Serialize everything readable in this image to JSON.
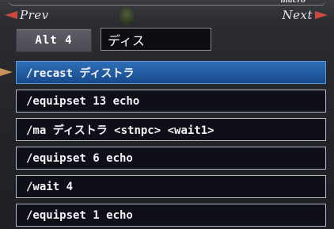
{
  "header": {
    "prev_label": "Prev",
    "next_label": "Next",
    "macro_label": "macro"
  },
  "set": {
    "alt_label": "Alt 4",
    "macro_name": "ディス"
  },
  "macro_lines": [
    "/recast ディストラ",
    "/equipset 13 echo",
    "/ma ディストラ <stnpc> <wait1>",
    "/equipset 6 echo",
    "/wait 4",
    "/equipset 1 echo"
  ],
  "selected_line": 0,
  "colors": {
    "selected_bg": "#2e6fb8",
    "arrow": "#c94a3c",
    "pointer": "#c8935a"
  },
  "icons": {
    "prev": "arrow-left-icon",
    "next": "arrow-right-icon",
    "emblem": "crest-icon",
    "pointer": "hand-pointer-icon"
  }
}
